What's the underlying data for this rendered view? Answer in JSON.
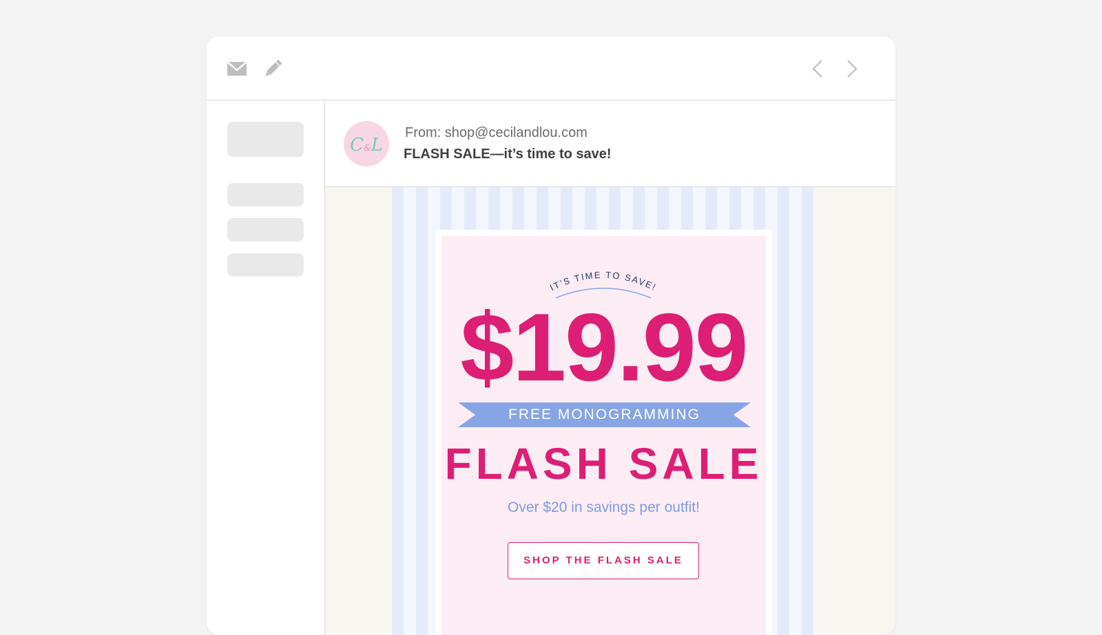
{
  "toolbar": {
    "left_icons": [
      "mail-icon",
      "pencil-icon"
    ],
    "right_icons": [
      "chevron-left-icon",
      "chevron-right-icon"
    ]
  },
  "email": {
    "avatar_monogram": "C&L",
    "from": "From: shop@cecilandlou.com",
    "subject": "FLASH SALE—it’s time to save!"
  },
  "promo": {
    "tagline": "IT’S TIME TO SAVE!",
    "price": "$19.99",
    "ribbon": "FREE MONOGRAMMING",
    "headline": "FLASH SALE",
    "savings": "Over $20 in savings per outfit!",
    "cta_label": "SHOP THE FLASH SALE"
  },
  "colors": {
    "brand_pink": "#dc1f75",
    "ribbon_blue": "#87a4e5",
    "card_background": "#fcedf5",
    "stripe_blue": "#e5eafb"
  }
}
